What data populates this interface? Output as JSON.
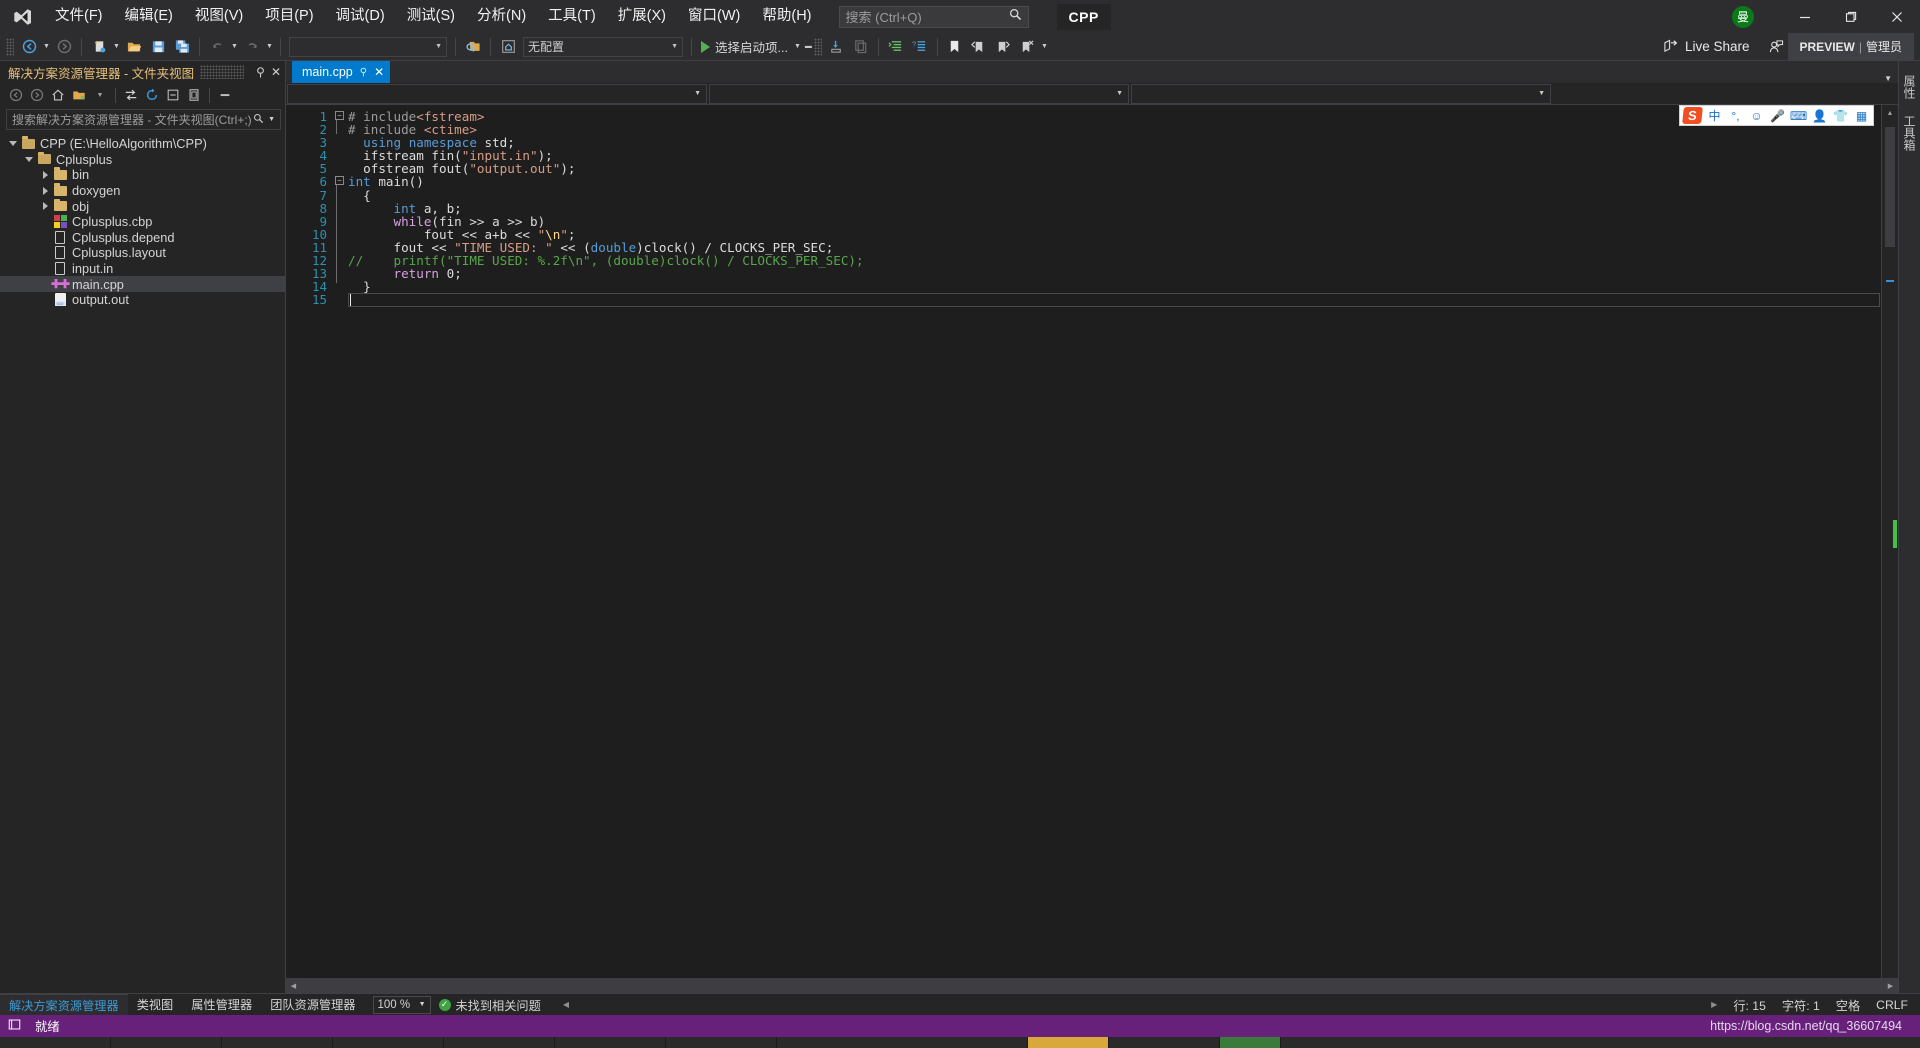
{
  "window": {
    "logo": "vs-logo",
    "ime_badge": "曼",
    "minimize": "—",
    "maximize": "❐",
    "close": "✕"
  },
  "menu": {
    "items": [
      {
        "label": "文件(F)",
        "name": "menu-file"
      },
      {
        "label": "编辑(E)",
        "name": "menu-edit"
      },
      {
        "label": "视图(V)",
        "name": "menu-view"
      },
      {
        "label": "项目(P)",
        "name": "menu-project"
      },
      {
        "label": "调试(D)",
        "name": "menu-debug"
      },
      {
        "label": "测试(S)",
        "name": "menu-test"
      },
      {
        "label": "分析(N)",
        "name": "menu-analyze"
      },
      {
        "label": "工具(T)",
        "name": "menu-tools"
      },
      {
        "label": "扩展(X)",
        "name": "menu-extensions"
      },
      {
        "label": "窗口(W)",
        "name": "menu-window"
      },
      {
        "label": "帮助(H)",
        "name": "menu-help"
      }
    ],
    "search_placeholder": "搜索 (Ctrl+Q)",
    "project_chip": "CPP"
  },
  "toolbar": {
    "config_combo": "无配置",
    "platform_combo": "",
    "run_label": "选择启动项...",
    "live_share": "Live Share",
    "preview_label": "PREVIEW",
    "preview_sep": "|",
    "preview_admin": "管理员"
  },
  "solution_explorer": {
    "title": "解决方案资源管理器 - 文件夹视图",
    "search_placeholder": "搜索解决方案资源管理器 - 文件夹视图(Ctrl+;)",
    "tree": [
      {
        "label": "CPP (E:\\HelloAlgorithm\\CPP)",
        "depth": 0,
        "icon": "folder-open",
        "twisty": "down",
        "selected": false
      },
      {
        "label": "Cplusplus",
        "depth": 1,
        "icon": "folder-open",
        "twisty": "down",
        "selected": false
      },
      {
        "label": "bin",
        "depth": 2,
        "icon": "folder",
        "twisty": "right",
        "selected": false
      },
      {
        "label": "doxygen",
        "depth": 2,
        "icon": "folder",
        "twisty": "right",
        "selected": false
      },
      {
        "label": "obj",
        "depth": 2,
        "icon": "folder",
        "twisty": "right",
        "selected": false
      },
      {
        "label": "Cplusplus.cbp",
        "depth": 2,
        "icon": "cbp",
        "twisty": "none",
        "selected": false
      },
      {
        "label": "Cplusplus.depend",
        "depth": 2,
        "icon": "file",
        "twisty": "none",
        "selected": false
      },
      {
        "label": "Cplusplus.layout",
        "depth": 2,
        "icon": "file",
        "twisty": "none",
        "selected": false
      },
      {
        "label": "input.in",
        "depth": 2,
        "icon": "file",
        "twisty": "none",
        "selected": false
      },
      {
        "label": "main.cpp",
        "depth": 2,
        "icon": "cpp",
        "twisty": "none",
        "selected": true
      },
      {
        "label": "output.out",
        "depth": 2,
        "icon": "output",
        "twisty": "none",
        "selected": false
      }
    ]
  },
  "editor": {
    "tab_title": "main.cpp",
    "tab_pin": "⚲",
    "tab_close": "✕",
    "nav_scope": "",
    "nav_member": "",
    "line_count": 15,
    "lines": [
      {
        "n": 1,
        "tokens": [
          {
            "t": "# include",
            "c": "pp"
          },
          {
            "t": "<fstream>",
            "c": "str"
          }
        ]
      },
      {
        "n": 2,
        "tokens": [
          {
            "t": "# include ",
            "c": "pp"
          },
          {
            "t": "<ctime>",
            "c": "str"
          }
        ]
      },
      {
        "n": 3,
        "tokens": [
          {
            "t": "  ",
            "c": "plain"
          },
          {
            "t": "using",
            "c": "kw"
          },
          {
            "t": " ",
            "c": "plain"
          },
          {
            "t": "namespace",
            "c": "kw"
          },
          {
            "t": " std;",
            "c": "plain"
          }
        ]
      },
      {
        "n": 4,
        "tokens": [
          {
            "t": "  ifstream fin(",
            "c": "plain"
          },
          {
            "t": "\"input.in\"",
            "c": "str"
          },
          {
            "t": ");",
            "c": "plain"
          }
        ]
      },
      {
        "n": 5,
        "tokens": [
          {
            "t": "  ofstream fout(",
            "c": "plain"
          },
          {
            "t": "\"output.out\"",
            "c": "str"
          },
          {
            "t": ");",
            "c": "plain"
          }
        ]
      },
      {
        "n": 6,
        "tokens": [
          {
            "t": "int",
            "c": "kw"
          },
          {
            "t": " main()",
            "c": "plain"
          }
        ]
      },
      {
        "n": 7,
        "tokens": [
          {
            "t": "  {",
            "c": "plain"
          }
        ]
      },
      {
        "n": 8,
        "tokens": [
          {
            "t": "      ",
            "c": "plain"
          },
          {
            "t": "int",
            "c": "kw"
          },
          {
            "t": " a, b;",
            "c": "plain"
          }
        ]
      },
      {
        "n": 9,
        "tokens": [
          {
            "t": "      ",
            "c": "plain"
          },
          {
            "t": "while",
            "c": "kw2"
          },
          {
            "t": "(fin >> a >> b)",
            "c": "plain"
          }
        ]
      },
      {
        "n": 10,
        "tokens": [
          {
            "t": "          fout << a+b << ",
            "c": "plain"
          },
          {
            "t": "\"",
            "c": "str"
          },
          {
            "t": "\\n",
            "c": "esc"
          },
          {
            "t": "\"",
            "c": "str"
          },
          {
            "t": ";",
            "c": "plain"
          }
        ]
      },
      {
        "n": 11,
        "tokens": [
          {
            "t": "      fout << ",
            "c": "plain"
          },
          {
            "t": "\"TIME USED: \"",
            "c": "str"
          },
          {
            "t": " << (",
            "c": "plain"
          },
          {
            "t": "double",
            "c": "kw"
          },
          {
            "t": ")clock() / CLOCKS_PER_SEC;",
            "c": "plain"
          }
        ]
      },
      {
        "n": 12,
        "tokens": [
          {
            "t": "//    printf(\"TIME USED: %.2f\\n\", (double)clock() / CLOCKS_PER_SEC);",
            "c": "cmt"
          }
        ]
      },
      {
        "n": 13,
        "tokens": [
          {
            "t": "      ",
            "c": "plain"
          },
          {
            "t": "return",
            "c": "kw2"
          },
          {
            "t": " ",
            "c": "plain"
          },
          {
            "t": "0",
            "c": "plain"
          },
          {
            "t": ";",
            "c": "plain"
          }
        ]
      },
      {
        "n": 14,
        "tokens": [
          {
            "t": "  }",
            "c": "plain"
          }
        ]
      },
      {
        "n": 15,
        "tokens": [
          {
            "t": "",
            "c": "plain"
          }
        ]
      }
    ]
  },
  "ime_toolbar": {
    "logo": "S",
    "items": [
      {
        "glyph": "中",
        "name": "ime-chinese-mode"
      },
      {
        "glyph": "°,",
        "name": "ime-punctuation"
      },
      {
        "glyph": "☺",
        "name": "ime-emoji"
      },
      {
        "glyph": "🎤",
        "name": "ime-voice-input"
      },
      {
        "glyph": "⌨",
        "name": "ime-soft-keyboard"
      },
      {
        "glyph": "👤",
        "name": "ime-user"
      },
      {
        "glyph": "👕",
        "name": "ime-skin"
      },
      {
        "glyph": "▦",
        "name": "ime-toolbox"
      }
    ]
  },
  "bottom_tabs": {
    "tabs": [
      {
        "label": "解决方案资源管理器",
        "active": true
      },
      {
        "label": "类视图",
        "active": false
      },
      {
        "label": "属性管理器",
        "active": false
      },
      {
        "label": "团队资源管理器",
        "active": false
      }
    ],
    "zoom": "100 %",
    "issues": "未找到相关问题",
    "line_label": "行: 15",
    "col_label": "字符: 1",
    "space_label": "空格",
    "eol_label": "CRLF"
  },
  "statusbar": {
    "ready": "就绪",
    "url": "https://blog.csdn.net/qq_36607494"
  },
  "right_rail": {
    "tabs": [
      "属性",
      "工具箱"
    ]
  },
  "colors": {
    "accent_blue": "#007acc",
    "status_purple": "#68217a",
    "chrome": "#2d2d30",
    "editor_bg": "#1e1e1e",
    "panel_bg": "#252526"
  }
}
